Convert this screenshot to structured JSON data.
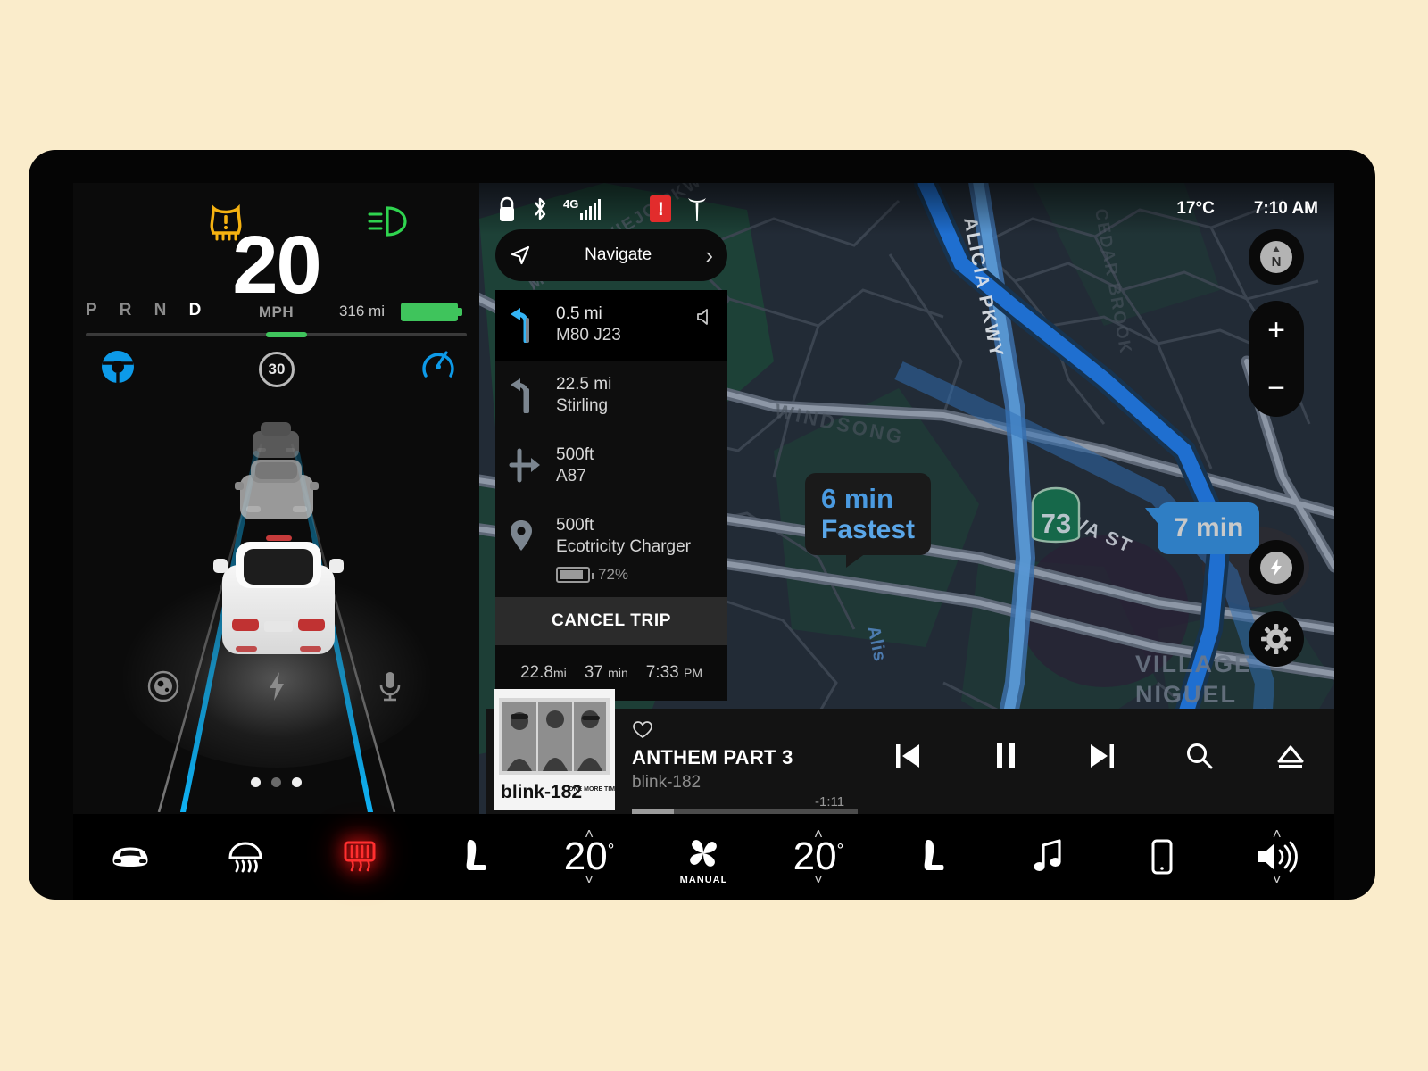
{
  "cluster": {
    "speed": "20",
    "speed_unit": "MPH",
    "gears": [
      "P",
      "R",
      "N",
      "D"
    ],
    "active_gear": "D",
    "range": "316 mi",
    "speed_limit": "30",
    "warning_icon": "tpms-warning-icon",
    "beam_icon": "low-beam-icon",
    "autosteer_icon": "autosteer-wheel-icon",
    "cruise_icon": "cruise-control-icon",
    "bottom_icons": [
      "camera-icon",
      "bolt-icon",
      "microphone-icon"
    ],
    "page_dots": 3,
    "active_dot": 1
  },
  "statusbar": {
    "icons": [
      "lock-icon",
      "bluetooth-icon",
      "cellular-4g-icon",
      "alert-icon",
      "tesla-logo-icon"
    ],
    "alert_glyph": "!",
    "cellular_label": "4G",
    "temperature": "17°C",
    "time": "7:10 AM"
  },
  "navigate": {
    "label": "Navigate",
    "nav_icon": "navigation-arrow-icon",
    "chevron": "›"
  },
  "directions": {
    "steps": [
      {
        "distance": "0.5 mi",
        "name": "M80  J23",
        "icon": "turn-left-icon",
        "current": true,
        "speaker_icon": "speaker-mute-icon"
      },
      {
        "distance": "22.5 mi",
        "name": "Stirling",
        "icon": "turn-left-icon",
        "current": false
      },
      {
        "distance": "500ft",
        "name": "A87",
        "icon": "continue-straight-icon",
        "current": false
      },
      {
        "distance": "500ft",
        "name": "Ecotricity Charger",
        "icon": "map-pin-icon",
        "current": false,
        "charge_pct": "72%"
      }
    ],
    "cancel_label": "CANCEL TRIP",
    "summary": {
      "distance": "22.8",
      "distance_unit": "mi",
      "duration": "37",
      "duration_unit": "min",
      "eta": "7:33",
      "eta_suffix": "PM"
    }
  },
  "map": {
    "route_bubbles": [
      {
        "time": "6 min",
        "note": "Fastest"
      },
      {
        "time": "7 min",
        "note": ""
      }
    ],
    "labels": [
      {
        "text": "ALICIA PKWY"
      },
      {
        "text": "EVA ST"
      },
      {
        "text": "VILLAGE"
      },
      {
        "text": "NIGUEL"
      },
      {
        "text": "Alis"
      },
      {
        "text": "WINDSONG"
      },
      {
        "text": "CEDAR BROOK"
      },
      {
        "text": "MISSION VIEJO PKWY"
      }
    ],
    "shield": "73",
    "controls": {
      "compass": "N",
      "compass_icon": "compass-north-icon",
      "zoom_in": "+",
      "zoom_out": "−",
      "charge_icon": "charging-bolt-icon",
      "settings_icon": "gear-icon"
    },
    "colors": {
      "land": "#222b36",
      "park": "#1d4437",
      "route": "#1f6fd0",
      "alt_route": "#5b9ad6",
      "road": "#6e7a8a"
    }
  },
  "media": {
    "title": "ANTHEM PART 3",
    "artist": "blink-182",
    "remaining": "-1:11",
    "album_text": "blink-182",
    "album_sub": "ONE MORE TIME...",
    "favorite_icon": "heart-icon",
    "controls": [
      "previous-icon",
      "pause-icon",
      "next-icon",
      "search-icon",
      "eject-icon"
    ],
    "progress_pct": 18
  },
  "climate": {
    "items": [
      {
        "name": "car-icon",
        "type": "icon"
      },
      {
        "name": "front-defrost-icon",
        "type": "icon"
      },
      {
        "name": "rear-defrost-icon",
        "type": "icon",
        "active": true
      },
      {
        "name": "driver-seat-heater-icon",
        "type": "icon"
      },
      {
        "name": "driver-temp",
        "type": "temp",
        "value": "20",
        "unit": "°"
      },
      {
        "name": "fan-icon",
        "type": "fan",
        "label": "MANUAL"
      },
      {
        "name": "passenger-temp",
        "type": "temp",
        "value": "20",
        "unit": "°"
      },
      {
        "name": "passenger-seat-heater-icon",
        "type": "icon"
      },
      {
        "name": "media-icon",
        "type": "icon"
      },
      {
        "name": "phone-icon",
        "type": "icon"
      },
      {
        "name": "volume",
        "type": "volume"
      }
    ],
    "chevron_up": "˄",
    "chevron_down": "˅"
  }
}
